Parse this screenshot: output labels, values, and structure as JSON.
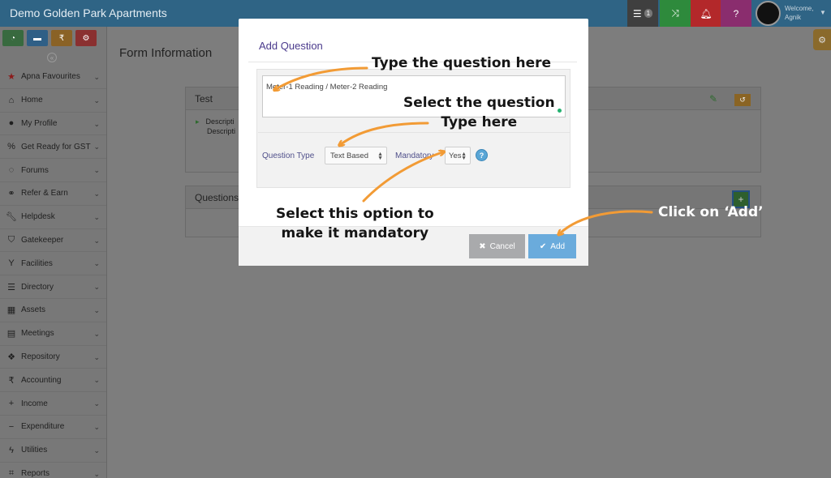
{
  "app": {
    "title": "Demo Golden Park Apartments",
    "user_greeting": "Welcome,",
    "user_name": "Agnik",
    "notification_count": "1"
  },
  "sidebar": {
    "items": [
      {
        "label": "Apna Favourites",
        "icon": "star-icon"
      },
      {
        "label": "Home",
        "icon": "home-icon"
      },
      {
        "label": "My Profile",
        "icon": "user-icon"
      },
      {
        "label": "Get Ready for GST",
        "icon": "percent-icon"
      },
      {
        "label": "Forums",
        "icon": "chat-icon"
      },
      {
        "label": "Refer & Earn",
        "icon": "handshake-icon"
      },
      {
        "label": "Helpdesk",
        "icon": "wrench-icon"
      },
      {
        "label": "Gatekeeper",
        "icon": "shield-icon"
      },
      {
        "label": "Facilities",
        "icon": "glass-icon"
      },
      {
        "label": "Directory",
        "icon": "list-icon"
      },
      {
        "label": "Assets",
        "icon": "building-icon"
      },
      {
        "label": "Meetings",
        "icon": "calendar-icon"
      },
      {
        "label": "Repository",
        "icon": "dropbox-icon"
      },
      {
        "label": "Accounting",
        "icon": "rupee-icon"
      },
      {
        "label": "Income",
        "icon": "plus-icon"
      },
      {
        "label": "Expenditure",
        "icon": "minus-icon"
      },
      {
        "label": "Utilities",
        "icon": "bolt-icon"
      },
      {
        "label": "Reports",
        "icon": "chart-icon"
      }
    ]
  },
  "main": {
    "page_title": "Form Information",
    "test_panel": {
      "title": "Test",
      "line1": "Descripti",
      "line2": "Descripti"
    },
    "questions_panel": {
      "title": "Questions"
    }
  },
  "modal": {
    "title": "Add Question",
    "question_value": "Meter-1 Reading / Meter-2 Reading",
    "question_type_label": "Question Type",
    "question_type_value": "Text Based",
    "mandatory_label": "Mandatory",
    "mandatory_value": "Yes",
    "help_symbol": "?",
    "cancel_label": "Cancel",
    "add_label": "Add"
  },
  "annotations": {
    "type_question": "Type the question here",
    "select_question_type_line1": "Select the question",
    "select_question_type_line2": "Type here",
    "mandatory_line1": "Select this option to",
    "mandatory_line2": "make it mandatory",
    "click_add": "Click on ‘Add’"
  },
  "colors": {
    "topbar": "#2f6485",
    "modal_title": "#4a3a8c",
    "add_button": "#6aabdc",
    "cancel_button": "#a9aaac",
    "arrow": "#f29b35"
  }
}
